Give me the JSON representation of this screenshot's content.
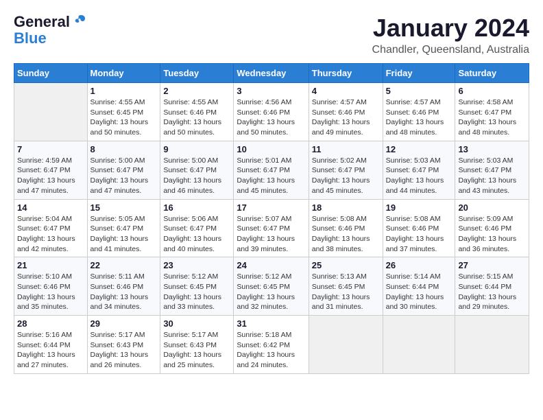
{
  "logo": {
    "line1": "General",
    "line2": "Blue"
  },
  "title": "January 2024",
  "subtitle": "Chandler, Queensland, Australia",
  "days_header": [
    "Sunday",
    "Monday",
    "Tuesday",
    "Wednesday",
    "Thursday",
    "Friday",
    "Saturday"
  ],
  "weeks": [
    [
      {
        "num": "",
        "info": ""
      },
      {
        "num": "1",
        "info": "Sunrise: 4:55 AM\nSunset: 6:45 PM\nDaylight: 13 hours\nand 50 minutes."
      },
      {
        "num": "2",
        "info": "Sunrise: 4:55 AM\nSunset: 6:46 PM\nDaylight: 13 hours\nand 50 minutes."
      },
      {
        "num": "3",
        "info": "Sunrise: 4:56 AM\nSunset: 6:46 PM\nDaylight: 13 hours\nand 50 minutes."
      },
      {
        "num": "4",
        "info": "Sunrise: 4:57 AM\nSunset: 6:46 PM\nDaylight: 13 hours\nand 49 minutes."
      },
      {
        "num": "5",
        "info": "Sunrise: 4:57 AM\nSunset: 6:46 PM\nDaylight: 13 hours\nand 48 minutes."
      },
      {
        "num": "6",
        "info": "Sunrise: 4:58 AM\nSunset: 6:47 PM\nDaylight: 13 hours\nand 48 minutes."
      }
    ],
    [
      {
        "num": "7",
        "info": "Sunrise: 4:59 AM\nSunset: 6:47 PM\nDaylight: 13 hours\nand 47 minutes."
      },
      {
        "num": "8",
        "info": "Sunrise: 5:00 AM\nSunset: 6:47 PM\nDaylight: 13 hours\nand 47 minutes."
      },
      {
        "num": "9",
        "info": "Sunrise: 5:00 AM\nSunset: 6:47 PM\nDaylight: 13 hours\nand 46 minutes."
      },
      {
        "num": "10",
        "info": "Sunrise: 5:01 AM\nSunset: 6:47 PM\nDaylight: 13 hours\nand 45 minutes."
      },
      {
        "num": "11",
        "info": "Sunrise: 5:02 AM\nSunset: 6:47 PM\nDaylight: 13 hours\nand 45 minutes."
      },
      {
        "num": "12",
        "info": "Sunrise: 5:03 AM\nSunset: 6:47 PM\nDaylight: 13 hours\nand 44 minutes."
      },
      {
        "num": "13",
        "info": "Sunrise: 5:03 AM\nSunset: 6:47 PM\nDaylight: 13 hours\nand 43 minutes."
      }
    ],
    [
      {
        "num": "14",
        "info": "Sunrise: 5:04 AM\nSunset: 6:47 PM\nDaylight: 13 hours\nand 42 minutes."
      },
      {
        "num": "15",
        "info": "Sunrise: 5:05 AM\nSunset: 6:47 PM\nDaylight: 13 hours\nand 41 minutes."
      },
      {
        "num": "16",
        "info": "Sunrise: 5:06 AM\nSunset: 6:47 PM\nDaylight: 13 hours\nand 40 minutes."
      },
      {
        "num": "17",
        "info": "Sunrise: 5:07 AM\nSunset: 6:47 PM\nDaylight: 13 hours\nand 39 minutes."
      },
      {
        "num": "18",
        "info": "Sunrise: 5:08 AM\nSunset: 6:46 PM\nDaylight: 13 hours\nand 38 minutes."
      },
      {
        "num": "19",
        "info": "Sunrise: 5:08 AM\nSunset: 6:46 PM\nDaylight: 13 hours\nand 37 minutes."
      },
      {
        "num": "20",
        "info": "Sunrise: 5:09 AM\nSunset: 6:46 PM\nDaylight: 13 hours\nand 36 minutes."
      }
    ],
    [
      {
        "num": "21",
        "info": "Sunrise: 5:10 AM\nSunset: 6:46 PM\nDaylight: 13 hours\nand 35 minutes."
      },
      {
        "num": "22",
        "info": "Sunrise: 5:11 AM\nSunset: 6:46 PM\nDaylight: 13 hours\nand 34 minutes."
      },
      {
        "num": "23",
        "info": "Sunrise: 5:12 AM\nSunset: 6:45 PM\nDaylight: 13 hours\nand 33 minutes."
      },
      {
        "num": "24",
        "info": "Sunrise: 5:12 AM\nSunset: 6:45 PM\nDaylight: 13 hours\nand 32 minutes."
      },
      {
        "num": "25",
        "info": "Sunrise: 5:13 AM\nSunset: 6:45 PM\nDaylight: 13 hours\nand 31 minutes."
      },
      {
        "num": "26",
        "info": "Sunrise: 5:14 AM\nSunset: 6:44 PM\nDaylight: 13 hours\nand 30 minutes."
      },
      {
        "num": "27",
        "info": "Sunrise: 5:15 AM\nSunset: 6:44 PM\nDaylight: 13 hours\nand 29 minutes."
      }
    ],
    [
      {
        "num": "28",
        "info": "Sunrise: 5:16 AM\nSunset: 6:44 PM\nDaylight: 13 hours\nand 27 minutes."
      },
      {
        "num": "29",
        "info": "Sunrise: 5:17 AM\nSunset: 6:43 PM\nDaylight: 13 hours\nand 26 minutes."
      },
      {
        "num": "30",
        "info": "Sunrise: 5:17 AM\nSunset: 6:43 PM\nDaylight: 13 hours\nand 25 minutes."
      },
      {
        "num": "31",
        "info": "Sunrise: 5:18 AM\nSunset: 6:42 PM\nDaylight: 13 hours\nand 24 minutes."
      },
      {
        "num": "",
        "info": ""
      },
      {
        "num": "",
        "info": ""
      },
      {
        "num": "",
        "info": ""
      }
    ]
  ]
}
